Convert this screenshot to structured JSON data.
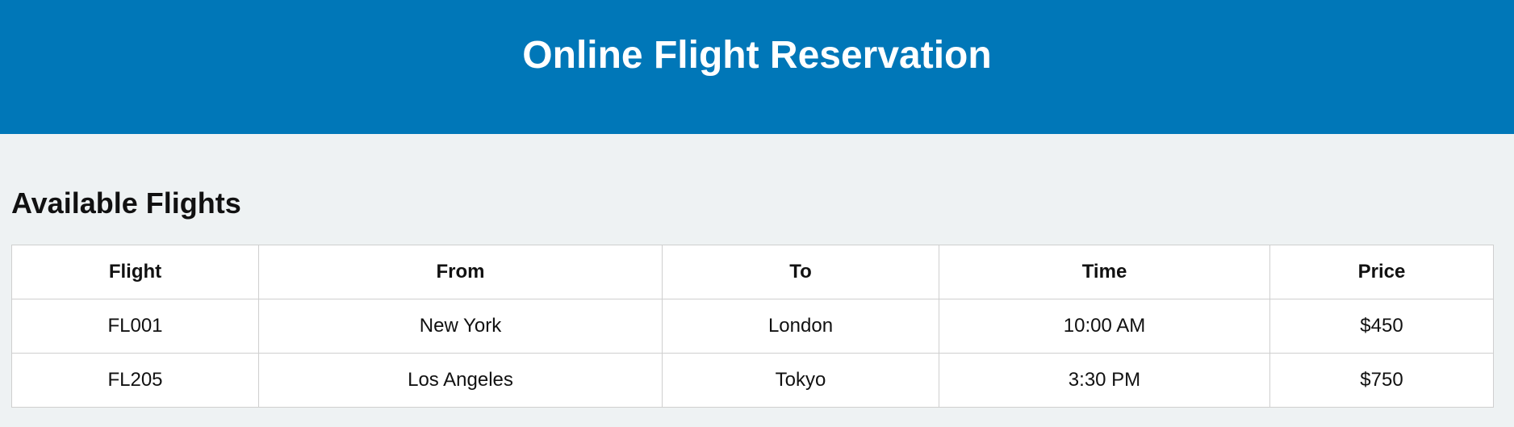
{
  "header": {
    "title": "Online Flight Reservation"
  },
  "flights_section": {
    "title": "Available Flights",
    "columns": [
      "Flight",
      "From",
      "To",
      "Time",
      "Price"
    ],
    "rows": [
      [
        "FL001",
        "New York",
        "London",
        "10:00 AM",
        "$450"
      ],
      [
        "FL205",
        "Los Angeles",
        "Tokyo",
        "3:30 PM",
        "$750"
      ]
    ]
  },
  "colors": {
    "header_bg": "#0077b8",
    "page_bg": "#eef2f3",
    "table_bg": "#ffffff",
    "border": "#cfcfcf"
  }
}
